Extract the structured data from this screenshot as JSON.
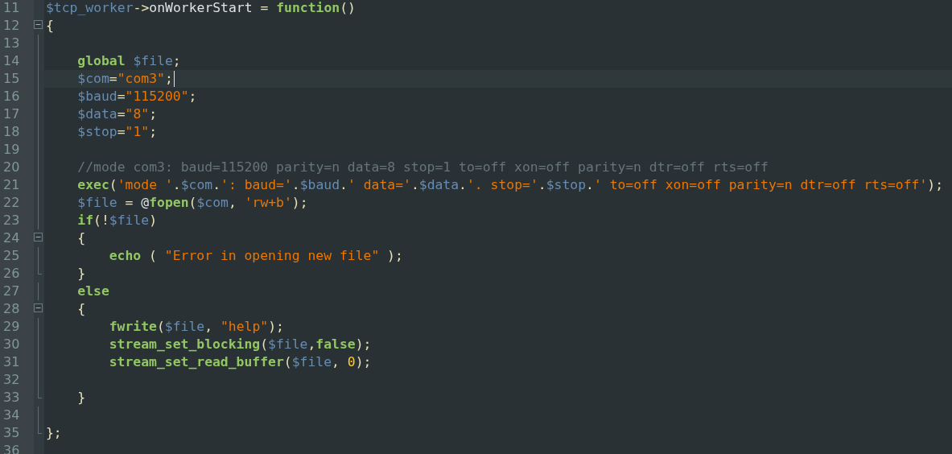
{
  "editor": {
    "lines": [
      {
        "number": "11",
        "kind": "plain",
        "current": false,
        "tokens": [
          {
            "kind": "var",
            "text": "$tcp_worker"
          },
          {
            "kind": "punct",
            "text": "->"
          },
          {
            "kind": "plain",
            "text": "onWorkerStart"
          },
          {
            "kind": "punct",
            "text": " = "
          },
          {
            "kind": "keyword",
            "text": "function"
          },
          {
            "kind": "punct",
            "text": "()"
          }
        ]
      },
      {
        "number": "12",
        "kind": "start",
        "current": false,
        "tokens": [
          {
            "kind": "punct",
            "text": "{"
          }
        ]
      },
      {
        "number": "13",
        "kind": "inside",
        "current": false
      },
      {
        "number": "14",
        "kind": "inside",
        "current": false,
        "tokens": [
          {
            "kind": "keyword",
            "text": "global "
          },
          {
            "kind": "var",
            "text": "$file"
          },
          {
            "kind": "punct",
            "text": ";"
          }
        ]
      },
      {
        "number": "15",
        "kind": "inside",
        "current": true,
        "tokens": [
          {
            "kind": "var",
            "text": "$com"
          },
          {
            "kind": "punct",
            "text": "="
          },
          {
            "kind": "string",
            "text": "\"com3\""
          },
          {
            "kind": "punct",
            "text": ";"
          }
        ]
      },
      {
        "number": "16",
        "kind": "inside",
        "current": false,
        "tokens": [
          {
            "kind": "var",
            "text": "$baud"
          },
          {
            "kind": "punct",
            "text": "="
          },
          {
            "kind": "string",
            "text": "\"115200\""
          },
          {
            "kind": "punct",
            "text": ";"
          }
        ]
      },
      {
        "number": "17",
        "kind": "inside",
        "current": false,
        "tokens": [
          {
            "kind": "var",
            "text": "$data"
          },
          {
            "kind": "punct",
            "text": "="
          },
          {
            "kind": "string",
            "text": "\"8\""
          },
          {
            "kind": "punct",
            "text": ";"
          }
        ]
      },
      {
        "number": "18",
        "kind": "inside",
        "current": false,
        "tokens": [
          {
            "kind": "var",
            "text": "$stop"
          },
          {
            "kind": "punct",
            "text": "="
          },
          {
            "kind": "string",
            "text": "\"1\""
          },
          {
            "kind": "punct",
            "text": ";"
          }
        ]
      },
      {
        "number": "19",
        "kind": "inside",
        "current": false
      },
      {
        "number": "20",
        "kind": "inside",
        "current": false,
        "tokens": [
          {
            "kind": "comment",
            "text": "//mode com3: baud=115200 parity=n data=8 stop=1 to=off xon=off parity=n dtr=off rts=off"
          }
        ]
      },
      {
        "number": "21",
        "kind": "inside",
        "current": false,
        "tokens": [
          {
            "kind": "keyword",
            "text": "exec"
          },
          {
            "kind": "punct",
            "text": "("
          },
          {
            "kind": "string",
            "text": "'mode '"
          },
          {
            "kind": "punct",
            "text": "."
          },
          {
            "kind": "var",
            "text": "$com"
          },
          {
            "kind": "punct",
            "text": "."
          },
          {
            "kind": "string",
            "text": "': baud='"
          },
          {
            "kind": "punct",
            "text": "."
          },
          {
            "kind": "var",
            "text": "$baud"
          },
          {
            "kind": "punct",
            "text": "."
          },
          {
            "kind": "string",
            "text": "' data='"
          },
          {
            "kind": "punct",
            "text": "."
          },
          {
            "kind": "var",
            "text": "$data"
          },
          {
            "kind": "punct",
            "text": "."
          },
          {
            "kind": "string",
            "text": "'. stop='"
          },
          {
            "kind": "punct",
            "text": "."
          },
          {
            "kind": "var",
            "text": "$stop"
          },
          {
            "kind": "punct",
            "text": "."
          },
          {
            "kind": "string",
            "text": "' to=off xon=off parity=n dtr=off rts=off'"
          },
          {
            "kind": "punct",
            "text": ");"
          }
        ]
      },
      {
        "number": "22",
        "kind": "inside",
        "current": false,
        "tokens": [
          {
            "kind": "var",
            "text": "$file"
          },
          {
            "kind": "punct",
            "text": " = "
          },
          {
            "kind": "plain",
            "text": "@"
          },
          {
            "kind": "keyword",
            "text": "fopen"
          },
          {
            "kind": "punct",
            "text": "("
          },
          {
            "kind": "var",
            "text": "$com"
          },
          {
            "kind": "punct",
            "text": ", "
          },
          {
            "kind": "string",
            "text": "'rw+b'"
          },
          {
            "kind": "punct",
            "text": ");"
          }
        ]
      },
      {
        "number": "23",
        "kind": "inside",
        "current": false,
        "tokens": [
          {
            "kind": "keyword",
            "text": "if"
          },
          {
            "kind": "punct",
            "text": "(!"
          },
          {
            "kind": "var",
            "text": "$file"
          },
          {
            "kind": "punct",
            "text": ")"
          }
        ]
      },
      {
        "number": "24",
        "kind": "start",
        "current": false,
        "tokens": [
          {
            "kind": "punct",
            "text": "{"
          }
        ]
      },
      {
        "number": "25",
        "kind": "inside",
        "current": false,
        "tokens": [
          {
            "kind": "keyword",
            "text": "echo"
          },
          {
            "kind": "punct",
            "text": " ( "
          },
          {
            "kind": "string",
            "text": "\"Error in opening new file\""
          },
          {
            "kind": "punct",
            "text": " );"
          }
        ]
      },
      {
        "number": "26",
        "kind": "end",
        "current": false,
        "tokens": [
          {
            "kind": "punct",
            "text": "}"
          }
        ]
      },
      {
        "number": "27",
        "kind": "inside",
        "current": false,
        "tokens": [
          {
            "kind": "keyword",
            "text": "else"
          }
        ]
      },
      {
        "number": "28",
        "kind": "start",
        "current": false,
        "tokens": [
          {
            "kind": "punct",
            "text": "{"
          }
        ]
      },
      {
        "number": "29",
        "kind": "inside",
        "current": false,
        "tokens": [
          {
            "kind": "keyword",
            "text": "fwrite"
          },
          {
            "kind": "punct",
            "text": "("
          },
          {
            "kind": "var",
            "text": "$file"
          },
          {
            "kind": "punct",
            "text": ", "
          },
          {
            "kind": "string",
            "text": "\"help\""
          },
          {
            "kind": "punct",
            "text": ");"
          }
        ]
      },
      {
        "number": "30",
        "kind": "inside",
        "current": false,
        "tokens": [
          {
            "kind": "keyword",
            "text": "stream_set_blocking"
          },
          {
            "kind": "punct",
            "text": "("
          },
          {
            "kind": "var",
            "text": "$file"
          },
          {
            "kind": "punct",
            "text": ","
          },
          {
            "kind": "keyword",
            "text": "false"
          },
          {
            "kind": "punct",
            "text": ");"
          }
        ]
      },
      {
        "number": "31",
        "kind": "inside",
        "current": false,
        "tokens": [
          {
            "kind": "keyword",
            "text": "stream_set_read_buffer"
          },
          {
            "kind": "punct",
            "text": "("
          },
          {
            "kind": "var",
            "text": "$file"
          },
          {
            "kind": "punct",
            "text": ", "
          },
          {
            "kind": "number",
            "text": "0"
          },
          {
            "kind": "punct",
            "text": ");"
          }
        ]
      },
      {
        "number": "32",
        "kind": "inside",
        "current": false
      },
      {
        "number": "33",
        "kind": "end",
        "current": false,
        "tokens": [
          {
            "kind": "punct",
            "text": "}"
          }
        ]
      },
      {
        "number": "34",
        "kind": "inside",
        "current": false
      },
      {
        "number": "35",
        "kind": "end",
        "current": false,
        "tokens": [
          {
            "kind": "punct",
            "text": "};"
          }
        ]
      },
      {
        "number": "36",
        "kind": "plain",
        "current": false
      }
    ]
  }
}
